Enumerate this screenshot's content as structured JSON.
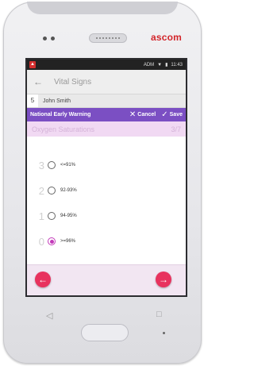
{
  "device": {
    "brand": "ascom"
  },
  "status_bar": {
    "carrier": "ADM",
    "time": "11:43"
  },
  "app_bar": {
    "back_icon": "arrow-left-icon",
    "title": "Vital Signs"
  },
  "patient": {
    "bed": "5",
    "name": "John Smith"
  },
  "form_bar": {
    "title": "National Early Warning",
    "cancel_label": "Cancel",
    "save_label": "Save"
  },
  "section": {
    "title": "Oxygen Saturations",
    "page": "3/7"
  },
  "options": [
    {
      "score": "3",
      "label": "<=91%",
      "selected": false
    },
    {
      "score": "2",
      "label": "92-93%",
      "selected": false
    },
    {
      "score": "1",
      "label": "94-95%",
      "selected": false
    },
    {
      "score": "0",
      "label": ">=96%",
      "selected": true
    }
  ],
  "nav": {
    "prev_icon": "arrow-left-circle-icon",
    "next_icon": "arrow-right-circle-icon"
  },
  "hardware_keys": {
    "back": "◁",
    "recents": "□"
  }
}
